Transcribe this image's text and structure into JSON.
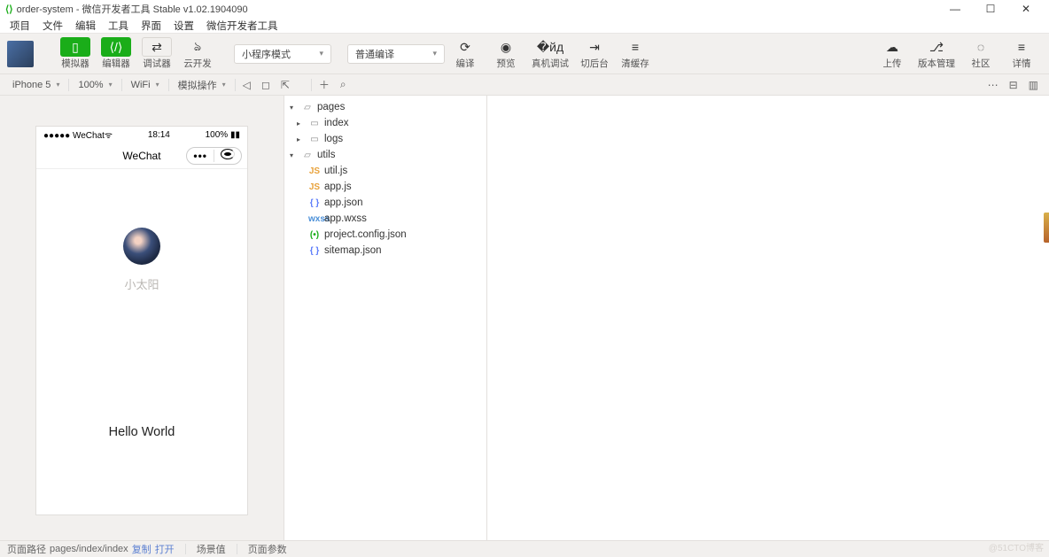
{
  "window": {
    "title": "order-system - 微信开发者工具 Stable v1.02.1904090"
  },
  "menu": {
    "items": [
      "项目",
      "文件",
      "编辑",
      "工具",
      "界面",
      "设置",
      "微信开发者工具"
    ]
  },
  "toolbar": {
    "simulator": "模拟器",
    "editor": "编辑器",
    "debugger": "调试器",
    "cloud": "云开发",
    "mode": {
      "label": "小程序模式"
    },
    "compileMode": {
      "label": "普通编译"
    },
    "compile": "编译",
    "preview": "预览",
    "remote": "真机调试",
    "background": "切后台",
    "clearcache": "清缓存",
    "upload": "上传",
    "version": "版本管理",
    "community": "社区",
    "detail": "详情"
  },
  "subbar": {
    "device": "iPhone 5",
    "zoom": "100%",
    "network": "WiFi",
    "simops": "模拟操作"
  },
  "sim": {
    "status": {
      "carrier": "●●●●● WeChat",
      "time": "18:14",
      "battery": "100%"
    },
    "nav": {
      "title": "WeChat"
    },
    "user": "小太阳",
    "hello": "Hello World"
  },
  "tree": {
    "pages": "pages",
    "index": "index",
    "logs": "logs",
    "utils": "utils",
    "utiljs": "util.js",
    "appjs": "app.js",
    "appjson": "app.json",
    "appwxss": "app.wxss",
    "projectcfg": "project.config.json",
    "sitemap": "sitemap.json"
  },
  "bottom": {
    "pathlabel": "页面路径",
    "path": "pages/index/index",
    "copy": "复制",
    "open": "打开",
    "scene": "场景值",
    "params": "页面参数"
  },
  "watermark": "@51CTO博客"
}
